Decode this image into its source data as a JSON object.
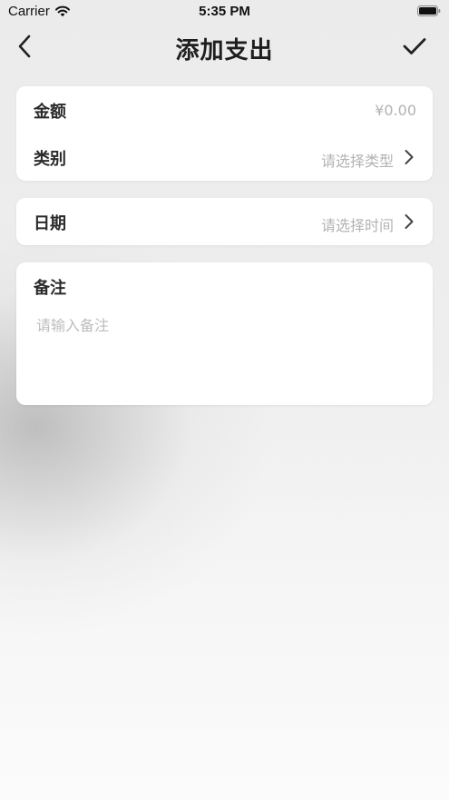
{
  "status_bar": {
    "carrier": "Carrier",
    "time": "5:35 PM",
    "icons": [
      "wifi-icon",
      "battery-icon"
    ]
  },
  "nav": {
    "title": "添加支出",
    "back_icon": "chevron-left-icon",
    "confirm_icon": "checkmark-icon"
  },
  "form": {
    "amount": {
      "label": "金额",
      "value": "¥0.00"
    },
    "category": {
      "label": "类别",
      "placeholder": "请选择类型",
      "icon": "chevron-right-icon"
    },
    "date": {
      "label": "日期",
      "placeholder": "请选择时间",
      "icon": "chevron-right-icon"
    },
    "note": {
      "label": "备注",
      "placeholder": "请输入备注"
    }
  },
  "colors": {
    "text": "#222222",
    "placeholder": "#b3b3b3",
    "card": "#ffffff"
  }
}
